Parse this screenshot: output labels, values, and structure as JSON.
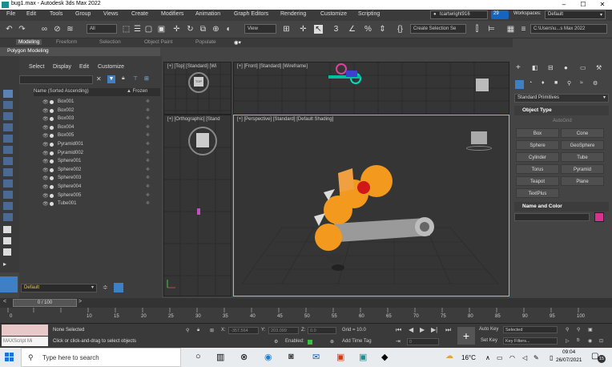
{
  "window": {
    "title": "bug1.max - Autodesk 3ds Max 2022",
    "minimize": "–",
    "maximize": "☐",
    "close": "✕"
  },
  "menu": [
    "File",
    "Edit",
    "Tools",
    "Group",
    "Views",
    "Create",
    "Modifiers",
    "Animation",
    "Graph Editors",
    "Rendering",
    "Customize",
    "Scripting"
  ],
  "user": {
    "name": "tcartwright916",
    "badge": "29",
    "workspaces_label": "Workspaces:",
    "workspace": "Default"
  },
  "toolbar": {
    "filter": "All",
    "view": "View",
    "selection_set": "Create Selection Se",
    "path": "C:\\Users\\u...s Max 2022"
  },
  "ribbon_tabs": [
    "Modeling",
    "Freeform",
    "Selection",
    "Object Paint",
    "Populate"
  ],
  "ribbon_sub": "Polygon Modeling",
  "scene_explorer": {
    "menu": [
      "Select",
      "Display",
      "Edit",
      "Customize"
    ],
    "col_name": "Name (Sorted Ascending)",
    "col_frozen": "▲ Frozen",
    "items": [
      "Box001",
      "Box002",
      "Box003",
      "Box004",
      "Box005",
      "Pyramid001",
      "Pyramid002",
      "Sphere001",
      "Sphere002",
      "Sphere003",
      "Sphere004",
      "Sphere005",
      "Tube001"
    ],
    "layer": "Default"
  },
  "viewports": {
    "top": "[+] [Top] [Standard] [Wi",
    "front": "[+] [Front] [Standard] [Wireframe]",
    "ortho": "[+] [Orthographic] [Stand",
    "persp": "[+] [Perspective] [Standard] [Default Shading]",
    "cube_top": "TOP"
  },
  "command_panel": {
    "category": "Standard Primitives",
    "object_type": "Object Type",
    "autogrid": "AutoGrid",
    "buttons": [
      "Box",
      "Cone",
      "Sphere",
      "GeoSphere",
      "Cylinder",
      "Tube",
      "Torus",
      "Pyramid",
      "Teapot",
      "Plane",
      "TextPlus"
    ],
    "name_color": "Name and Color",
    "color": "#d6338f"
  },
  "timeline": {
    "frame": "0 / 100",
    "ticks": [
      "0",
      "10",
      "15",
      "20",
      "25",
      "30",
      "35",
      "40",
      "45",
      "50",
      "55",
      "60",
      "65",
      "70",
      "75",
      "80",
      "85",
      "90",
      "95",
      "100"
    ]
  },
  "status": {
    "script_label": "MAXScript Mi",
    "none_selected": "None Selected",
    "hint": "Click or click-and-drag to select objects",
    "x_label": "X:",
    "x": "-357.564",
    "y_label": "Y:",
    "y": "203.099",
    "z_label": "Z:",
    "z": "0.0",
    "grid": "Grid = 10.0",
    "enabled": "Enabled:",
    "add_time_tag": "Add Time Tag",
    "auto_key": "Auto Key",
    "selected": "Selected",
    "set_key": "Set Key",
    "key_filters": "Key Filters...",
    "frame_field": "0"
  },
  "taskbar": {
    "search": "Type here to search",
    "temp": "16°C",
    "time": "09:04",
    "date": "26/07/2021",
    "notif": "15"
  }
}
